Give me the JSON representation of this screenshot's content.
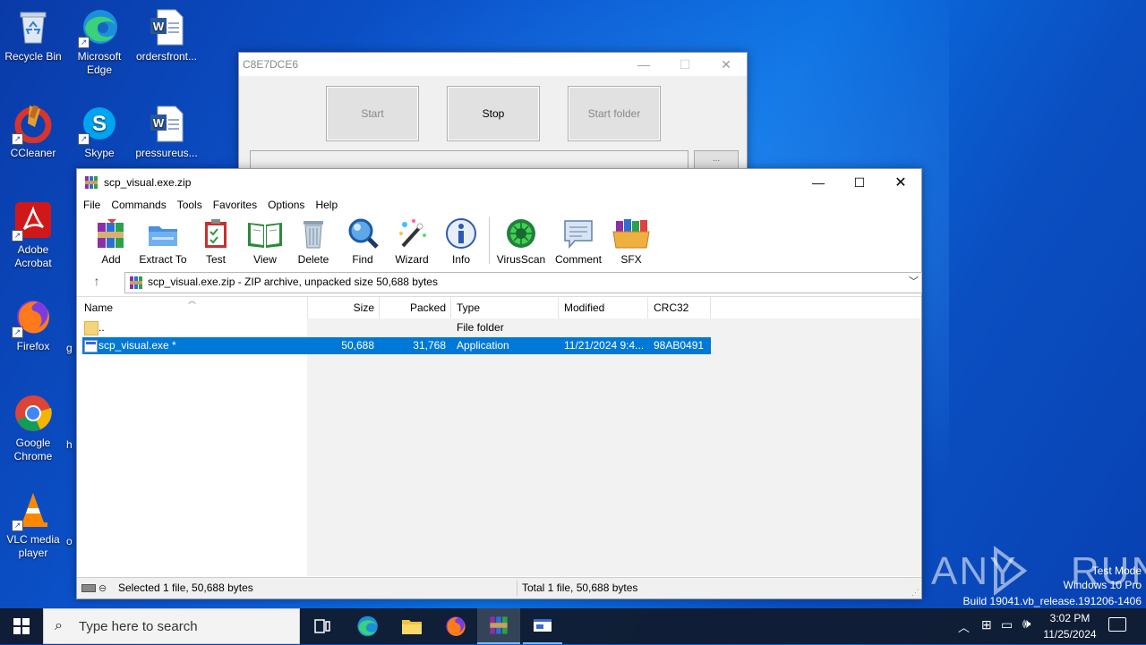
{
  "desktop": {
    "icons": [
      {
        "label": "Recycle Bin",
        "icon": "recycle-bin-icon"
      },
      {
        "label": "Microsoft Edge",
        "icon": "edge-icon"
      },
      {
        "label": "ordersfront...",
        "icon": "word-doc-icon"
      },
      {
        "label": "CCleaner",
        "icon": "ccleaner-icon"
      },
      {
        "label": "Skype",
        "icon": "skype-icon"
      },
      {
        "label": "pressureus...",
        "icon": "word-doc-icon"
      },
      {
        "label": "Adobe Acrobat",
        "icon": "acrobat-icon"
      },
      {
        "label": "Firefox",
        "icon": "firefox-icon"
      },
      {
        "label": "Google Chrome",
        "icon": "chrome-icon"
      },
      {
        "label": "VLC media player",
        "icon": "vlc-icon"
      }
    ],
    "clipped_labels": [
      "g",
      "h",
      "o"
    ],
    "watermark": {
      "brand": "ANY RUN",
      "mode": "Test Mode",
      "edition": "Windows 10 Pro",
      "build": "Build 19041.vb_release.191206-1406"
    }
  },
  "bg_window": {
    "title": "C8E7DCE6",
    "buttons": {
      "start": "Start",
      "stop": "Stop",
      "start_folder": "Start folder"
    },
    "browse": "..."
  },
  "winrar": {
    "title": "scp_visual.exe.zip",
    "menu": [
      "File",
      "Commands",
      "Tools",
      "Favorites",
      "Options",
      "Help"
    ],
    "toolbar": [
      {
        "label": "Add",
        "icon": "add-archive-icon"
      },
      {
        "label": "Extract To",
        "icon": "extract-folder-icon"
      },
      {
        "label": "Test",
        "icon": "test-clipboard-icon"
      },
      {
        "label": "View",
        "icon": "view-book-icon"
      },
      {
        "label": "Delete",
        "icon": "trash-icon"
      },
      {
        "label": "Find",
        "icon": "magnifier-icon"
      },
      {
        "label": "Wizard",
        "icon": "wand-icon"
      },
      {
        "label": "Info",
        "icon": "info-icon"
      },
      {
        "label": "VirusScan",
        "icon": "virus-icon"
      },
      {
        "label": "Comment",
        "icon": "comment-icon"
      },
      {
        "label": "SFX",
        "icon": "sfx-box-icon"
      }
    ],
    "path": "scp_visual.exe.zip - ZIP archive, unpacked size 50,688 bytes",
    "columns": [
      "Name",
      "Size",
      "Packed",
      "Type",
      "Modified",
      "CRC32"
    ],
    "rows": [
      {
        "name": "..",
        "size": "",
        "packed": "",
        "type": "File folder",
        "modified": "",
        "crc": ""
      },
      {
        "name": "scp_visual.exe *",
        "size": "50,688",
        "packed": "31,768",
        "type": "Application",
        "modified": "11/21/2024 9:4...",
        "crc": "98AB0491"
      }
    ],
    "status_left": "Selected 1 file, 50,688 bytes",
    "status_right": "Total 1 file, 50,688 bytes"
  },
  "taskbar": {
    "search_placeholder": "Type here to search",
    "time": "3:02 PM",
    "date": "11/25/2024"
  },
  "colors": {
    "selection": "#0078d7",
    "taskbar": "#101c30"
  }
}
